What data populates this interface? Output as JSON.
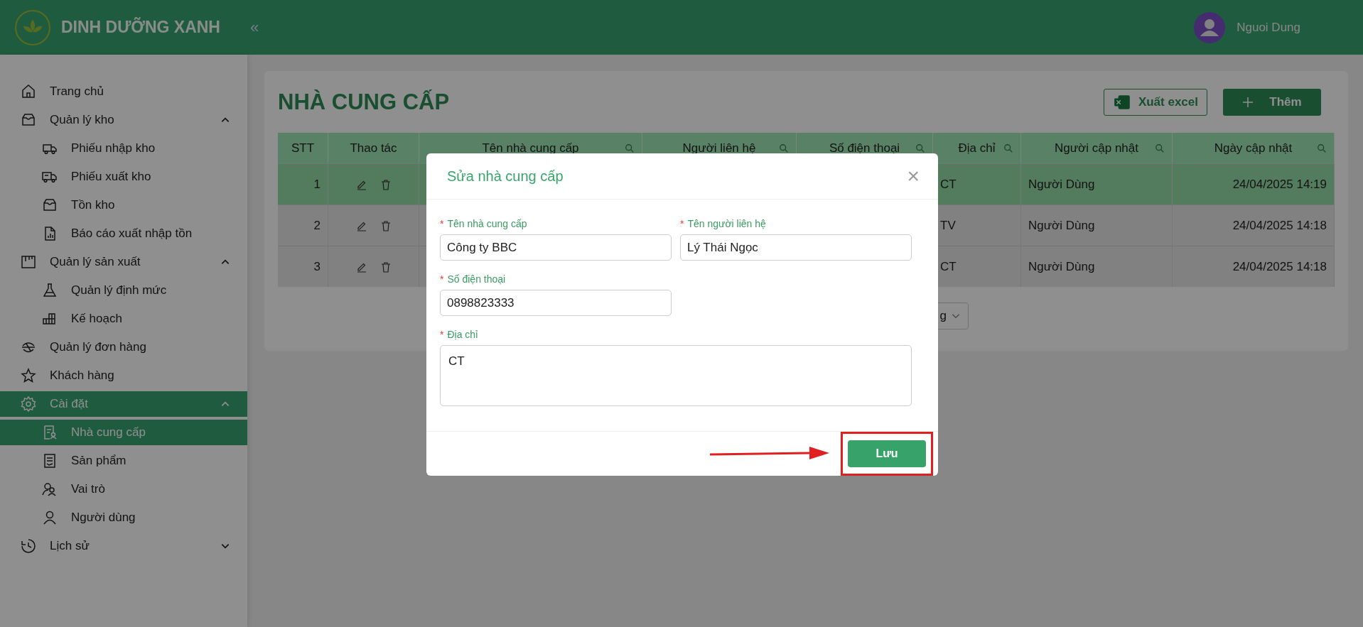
{
  "header": {
    "brand": "DINH DƯỠNG XANH",
    "collapse": "«",
    "user": "Nguoi Dung"
  },
  "sidebar": {
    "items": [
      {
        "label": "Trang chủ",
        "selected": false
      },
      {
        "label": "Quản lý kho",
        "selected": false,
        "expanded": true,
        "children": [
          {
            "label": "Phiếu nhập kho",
            "selected": false
          },
          {
            "label": "Phiếu xuất kho",
            "selected": false
          },
          {
            "label": "Tồn kho",
            "selected": false
          },
          {
            "label": "Báo cáo xuất nhập tồn",
            "selected": false
          }
        ]
      },
      {
        "label": "Quản lý sản xuất",
        "selected": false,
        "expanded": true,
        "children": [
          {
            "label": "Quản lý định mức",
            "selected": false
          },
          {
            "label": "Kế hoạch",
            "selected": false
          }
        ]
      },
      {
        "label": "Quản lý đơn hàng",
        "selected": false
      },
      {
        "label": "Khách hàng",
        "selected": false
      },
      {
        "label": "Cài đặt",
        "selected": true,
        "expanded": true,
        "children": [
          {
            "label": "Nhà cung cấp",
            "selected": true
          },
          {
            "label": "Sản phẩm",
            "selected": false
          },
          {
            "label": "Vai trò",
            "selected": false
          },
          {
            "label": "Người dùng",
            "selected": false
          }
        ]
      },
      {
        "label": "Lịch sử",
        "selected": false,
        "expanded": false
      }
    ]
  },
  "page": {
    "title": "NHÀ CUNG CẤP",
    "export_button": "Xuất excel",
    "add_button": "Thêm"
  },
  "table": {
    "columns": [
      {
        "label": "STT",
        "search": false
      },
      {
        "label": "Thao tác",
        "search": false
      },
      {
        "label": "Tên nhà cung cấp",
        "search": true
      },
      {
        "label": "Người liên hệ",
        "search": true
      },
      {
        "label": "Số điện thoại",
        "search": true
      },
      {
        "label": "Địa chỉ",
        "search": true
      },
      {
        "label": "Người cập nhật",
        "search": true
      },
      {
        "label": "Ngày cập nhật",
        "search": true
      }
    ],
    "rows": [
      {
        "stt": "1",
        "address": "CT",
        "updated_by": "Người Dùng",
        "updated_at": "24/04/2025 14:19",
        "selected": true
      },
      {
        "stt": "2",
        "address": "TV",
        "updated_by": "Người Dùng",
        "updated_at": "24/04/2025 14:18",
        "selected": false
      },
      {
        "stt": "3",
        "address": "CT",
        "updated_by": "Người Dùng",
        "updated_at": "24/04/2025 14:18",
        "selected": false
      }
    ]
  },
  "pagination": {
    "page_size": "g"
  },
  "modal": {
    "title": "Sửa nhà cung cấp",
    "close": "×",
    "fields": [
      {
        "label": "Tên nhà cung cấp",
        "value": "Công ty BBC",
        "required_mark": "*",
        "kind": "input"
      },
      {
        "label": "Tên người liên hệ",
        "value": "Lý Thái Ngọc",
        "required_mark": "*",
        "kind": "input"
      },
      {
        "label": "Số điện thoại",
        "value": "0898823333",
        "required_mark": "*",
        "kind": "input"
      },
      {
        "label": "Địa chỉ",
        "value": "CT",
        "required_mark": "*",
        "kind": "textarea"
      }
    ],
    "save_button": "Lưu"
  }
}
